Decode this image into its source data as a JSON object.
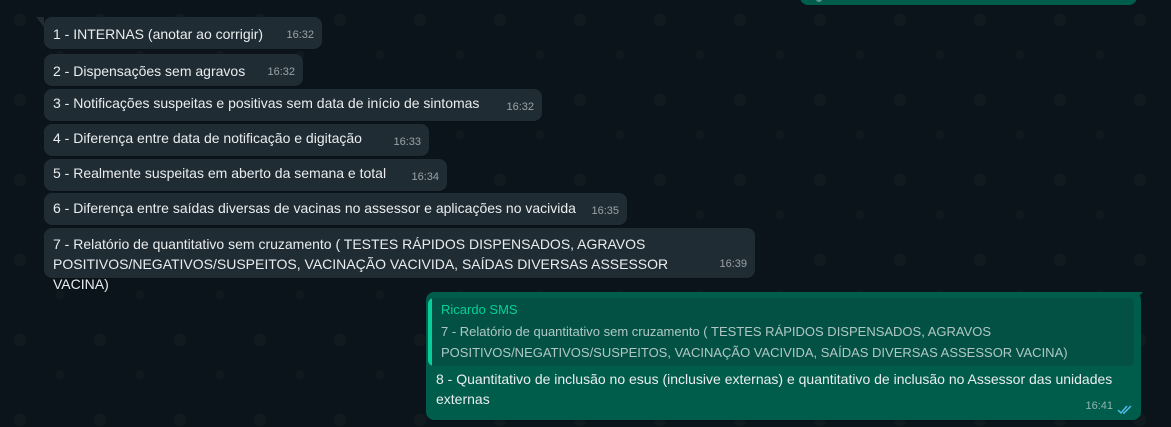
{
  "messages_in": [
    {
      "text": "1 - INTERNAS (anotar ao corrigir)",
      "time": "16:32"
    },
    {
      "text": "2 - Dispensações sem agravos",
      "time": "16:32"
    },
    {
      "text": "3 - Notificações suspeitas e positivas sem data de início de sintomas",
      "time": "16:32"
    },
    {
      "text": "4 - Diferença entre data de notificação e digitação",
      "time": "16:33"
    },
    {
      "text": "5 - Realmente suspeitas em aberto da semana e total",
      "time": "16:34"
    },
    {
      "text": "6 - Diferença entre saídas diversas de vacinas no assessor e aplicações no vacivida",
      "time": "16:35"
    },
    {
      "text": "7 - Relatório de quantitativo sem cruzamento ( TESTES RÁPIDOS DISPENSADOS, AGRAVOS POSITIVOS/NEGATIVOS/SUSPEITOS, VACINAÇÃO VACIVIDA, SAÍDAS DIVERSAS ASSESSOR VACINA)",
      "time": "16:39"
    }
  ],
  "reply": {
    "quoted_author": "Ricardo SMS",
    "quoted_text": "7 - Relatório de quantitativo sem cruzamento ( TESTES RÁPIDOS DISPENSADOS, AGRAVOS POSITIVOS/NEGATIVOS/SUSPEITOS, VACINAÇÃO VACIVIDA, SAÍDAS DIVERSAS ASSESSOR VACINA)",
    "text": "8 - Quantitativo de inclusão no esus (inclusive externas) e quantitativo de inclusão no Assessor das unidades externas",
    "time": "16:41",
    "status_icon": "double-check-read-icon"
  },
  "colors": {
    "background": "#0b141a",
    "incoming_bubble": "#202c33",
    "outgoing_bubble": "#005c4b",
    "quote_accent": "#06cf9c",
    "read_ticks": "#53bdeb"
  }
}
